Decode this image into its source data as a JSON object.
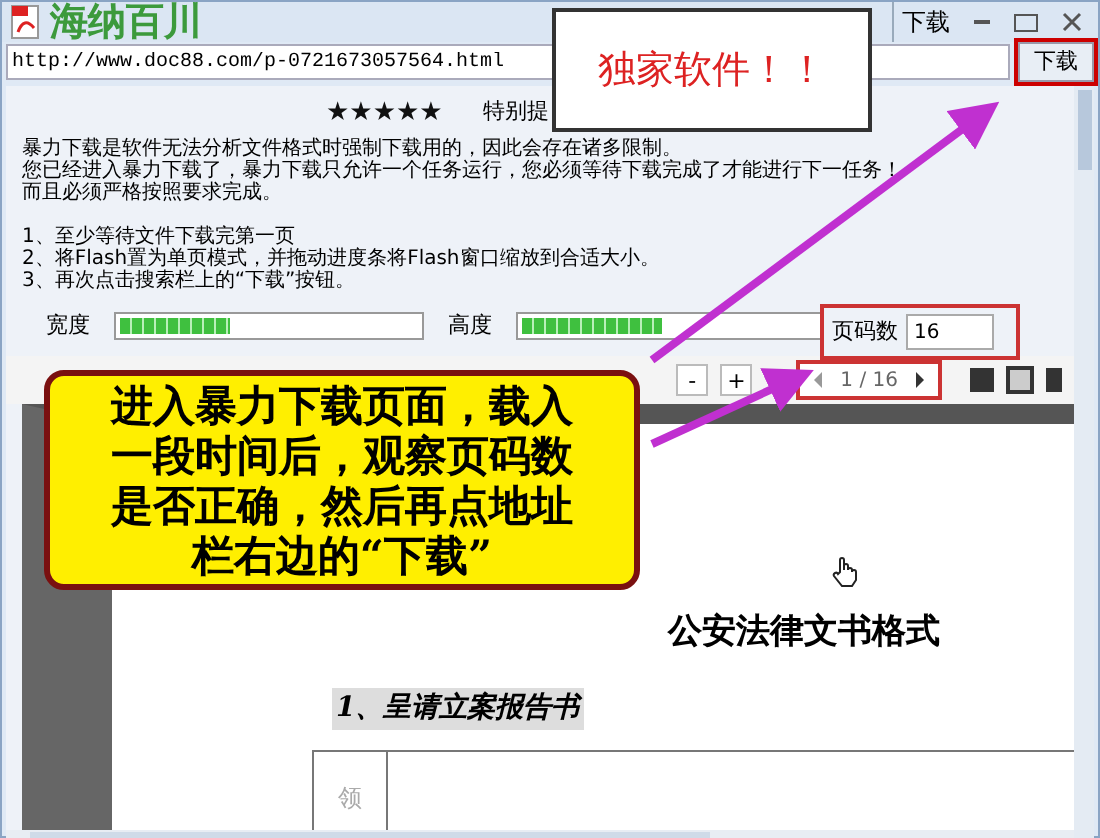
{
  "window": {
    "title": "海纳百川",
    "tab_label": "下载"
  },
  "address_bar": {
    "value": "http://www.doc88.com/p-0721673057564.html",
    "button": "下载"
  },
  "notice": {
    "stars": 5,
    "heading": "特别提"
  },
  "paragraph": [
    "暴力下载是软件无法分析文件格式时强制下载用的，因此会存在诸多限制。",
    "您已经进入暴力下载了，暴力下载只允许一个任务运行，您必须等待下载完成了才能进行下一任务！",
    "而且必须严格按照要求完成。"
  ],
  "steps": [
    "1、至少等待文件下载完第一页",
    "2、将Flash置为单页模式，并拖动进度条将Flash窗口缩放到合适大小。",
    "3、再次点击搜索栏上的“下载”按钮。"
  ],
  "measures": [
    {
      "label": "宽度",
      "level": 0.37
    },
    {
      "label": "高度",
      "level": 0.47
    }
  ],
  "page_count": {
    "label": "页码数",
    "value": "16"
  },
  "viewer_toolbar": {
    "zoom_out": "-",
    "zoom_in": "+",
    "page_indicator": "1 / 16"
  },
  "document": {
    "title": "公安法律文书格式",
    "section": "1、呈请立案报告书",
    "table_cell": "领"
  },
  "popup": {
    "text": "独家软件！！"
  },
  "callout": {
    "text": "进入暴力下载页面，载入一段时间后，观察页码数是否正确，然后再点地址栏右边的“下载”"
  }
}
